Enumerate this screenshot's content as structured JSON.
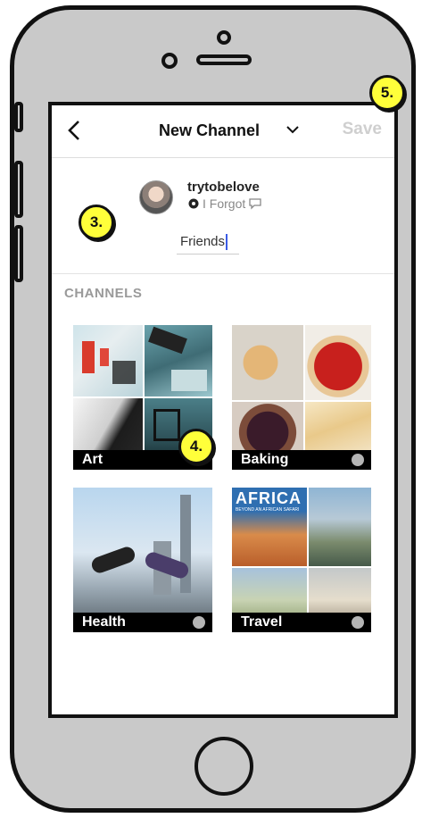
{
  "nav": {
    "title": "New Channel",
    "save_label": "Save"
  },
  "profile": {
    "username": "trytobelove",
    "status_text": "I Forgot"
  },
  "input": {
    "value": "Friends"
  },
  "section": {
    "title": "CHANNELS"
  },
  "channels": [
    {
      "name": "Art",
      "selected": true
    },
    {
      "name": "Baking",
      "selected": false
    },
    {
      "name": "Health",
      "selected": false
    },
    {
      "name": "Travel",
      "selected": false
    }
  ],
  "travel_cover": {
    "title": "AFRICA",
    "subtitle": "BEYOND AN AFRICAN SAFARI"
  },
  "annotations": {
    "badge3": "3.",
    "badge4": "4.",
    "badge5": "5."
  },
  "colors": {
    "badge": "#ffff3a",
    "caret": "#3b5ce6",
    "save_disabled": "#cfcfcf",
    "phone_body": "#c9c9c9"
  }
}
